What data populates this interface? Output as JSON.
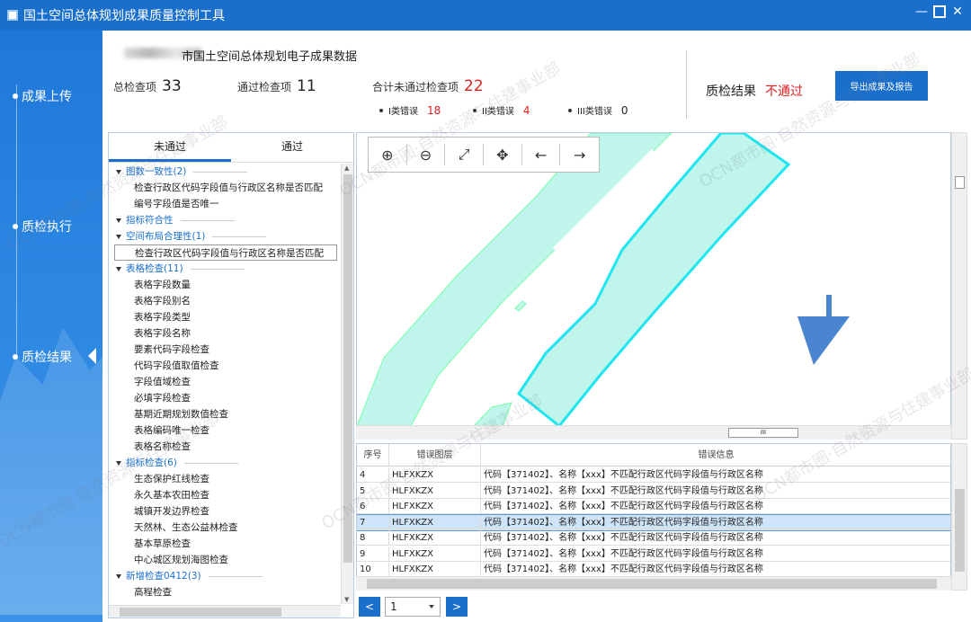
{
  "window": {
    "title": "国土空间总体规划成果质量控制工具",
    "controls": [
      "minimize",
      "maximize",
      "close"
    ]
  },
  "sidebar": {
    "items": [
      {
        "label": "成果上传"
      },
      {
        "label": "质检执行"
      },
      {
        "label": "质检结果",
        "active": true
      }
    ]
  },
  "summary": {
    "project_title": "市国土空间总体规划电子成果数据",
    "total_label": "总检查项",
    "total_value": "33",
    "passed_label": "通过检查项",
    "passed_value": "11",
    "failed_label": "合计未通过检查项",
    "failed_value": "22",
    "err1_label": "I类错误",
    "err1_value": "18",
    "err2_label": "II类错误",
    "err2_value": "4",
    "err3_label": "III类错误",
    "err3_value": "0",
    "result_label": "质检结果",
    "result_value": "不通过",
    "export_label": "导出成果及报告"
  },
  "tree": {
    "tabs": [
      "未通过",
      "通过"
    ],
    "nodes": [
      {
        "type": "group",
        "label": "图数一致性(2)"
      },
      {
        "type": "leaf",
        "label": "检查行政区代码字段值与行政区名称是否匹配"
      },
      {
        "type": "leaf",
        "label": "编号字段值是否唯一"
      },
      {
        "type": "group",
        "label": "指标符合性"
      },
      {
        "type": "group",
        "label": "空间布局合理性(1)"
      },
      {
        "type": "leaf",
        "label": "检查行政区代码字段值与行政区名称是否匹配",
        "selected": true
      },
      {
        "type": "group",
        "label": "表格检查(11)"
      },
      {
        "type": "leaf",
        "label": "表格字段数量"
      },
      {
        "type": "leaf",
        "label": "表格字段别名"
      },
      {
        "type": "leaf",
        "label": "表格字段类型"
      },
      {
        "type": "leaf",
        "label": "表格字段名称"
      },
      {
        "type": "leaf",
        "label": "要素代码字段检查"
      },
      {
        "type": "leaf",
        "label": "代码字段值取值检查"
      },
      {
        "type": "leaf",
        "label": "字段值域检查"
      },
      {
        "type": "leaf",
        "label": "必填字段检查"
      },
      {
        "type": "leaf",
        "label": "基期近期规划数值检查"
      },
      {
        "type": "leaf",
        "label": "表格编码唯一检查"
      },
      {
        "type": "leaf",
        "label": "表格名称检查"
      },
      {
        "type": "group",
        "label": "指标检查(6)"
      },
      {
        "type": "leaf",
        "label": "生态保护红线检查"
      },
      {
        "type": "leaf",
        "label": "永久基本农田检查"
      },
      {
        "type": "leaf",
        "label": "城镇开发边界检查"
      },
      {
        "type": "leaf",
        "label": "天然林、生态公益林检查"
      },
      {
        "type": "leaf",
        "label": "基本草原检查"
      },
      {
        "type": "leaf",
        "label": "中心城区规划海图检查"
      },
      {
        "type": "group",
        "label": "新增检查0412(3)"
      },
      {
        "type": "leaf",
        "label": "高程检查"
      }
    ]
  },
  "map": {
    "tools": [
      {
        "icon": "zoom-in-icon",
        "glyph": "⊕"
      },
      {
        "icon": "zoom-out-icon",
        "glyph": "⊖"
      },
      {
        "icon": "full-extent-icon",
        "glyph": "⤢"
      },
      {
        "icon": "pan-icon",
        "glyph": "✥"
      },
      {
        "icon": "back-icon",
        "glyph": "←"
      },
      {
        "icon": "forward-icon",
        "glyph": "→"
      }
    ],
    "hscroll_label": "III"
  },
  "errors": {
    "columns": [
      "序号",
      "错误图层",
      "错误信息"
    ],
    "rows": [
      {
        "no": "4",
        "layer": "HLFXKZX",
        "msg": "代码【371402】、名称【xxx】不匹配行政区代码字段值与行政区名称"
      },
      {
        "no": "5",
        "layer": "HLFXKZX",
        "msg": "代码【371402】、名称【xxx】不匹配行政区代码字段值与行政区名称"
      },
      {
        "no": "6",
        "layer": "HLFXKZX",
        "msg": "代码【371402】、名称【xxx】不匹配行政区代码字段值与行政区名称"
      },
      {
        "no": "7",
        "layer": "HLFXKZX",
        "msg": "代码【371402】、名称【xxx】不匹配行政区代码字段值与行政区名称",
        "selected": true
      },
      {
        "no": "8",
        "layer": "HLFXKZX",
        "msg": "代码【371402】、名称【xxx】不匹配行政区代码字段值与行政区名称"
      },
      {
        "no": "9",
        "layer": "HLFXKZX",
        "msg": "代码【371402】、名称【xxx】不匹配行政区代码字段值与行政区名称"
      },
      {
        "no": "10",
        "layer": "HLFXKZX",
        "msg": "代码【371402】、名称【xxx】不匹配行政区代码字段值与行政区名称"
      }
    ]
  },
  "pager": {
    "prev": "<",
    "next": ">",
    "page": "1"
  },
  "watermarks": [
    "OCN都市圈·自然资源与住建事业部"
  ],
  "colors": {
    "accent": "#1a6fcc",
    "error": "#e02020",
    "map_fill": "#bff5ea",
    "map_highlight": "#1ee6f0",
    "arrow": "#4a86cf"
  }
}
